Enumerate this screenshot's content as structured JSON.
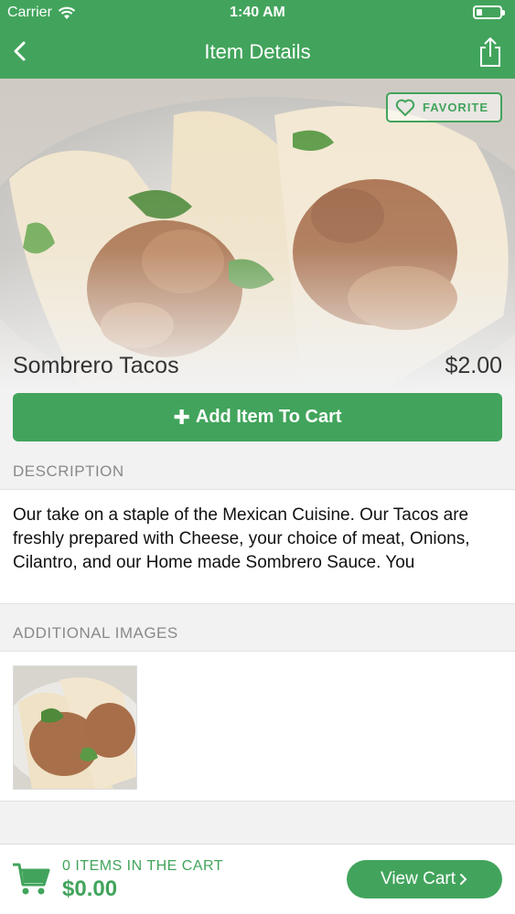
{
  "status_bar": {
    "carrier": "Carrier",
    "time": "1:40 AM"
  },
  "header": {
    "title": "Item Details",
    "back_icon": "chevron-left-icon",
    "share_icon": "share-icon"
  },
  "hero": {
    "favorite_label": "FAVORITE",
    "favorite_icon": "heart-outline-icon"
  },
  "item": {
    "name": "Sombrero Tacos",
    "price": "$2.00"
  },
  "add_to_cart": {
    "label": "Add Item To Cart",
    "icon": "plus-icon"
  },
  "description": {
    "heading": "DESCRIPTION",
    "text": "Our take on a staple of the Mexican Cuisine. Our Tacos are freshly prepared with Cheese, your choice of meat, Onions, Cilantro, and our Home made Sombrero Sauce. You"
  },
  "additional_images": {
    "heading": "ADDITIONAL IMAGES"
  },
  "cart_bar": {
    "count_label": "0 ITEMS IN THE CART",
    "total": "$0.00",
    "view_cart_label": "View Cart",
    "view_cart_icon": "chevron-right-icon",
    "cart_icon": "shopping-cart-icon"
  },
  "colors": {
    "accent": "#42a45c",
    "background": "#f2f2f2"
  }
}
